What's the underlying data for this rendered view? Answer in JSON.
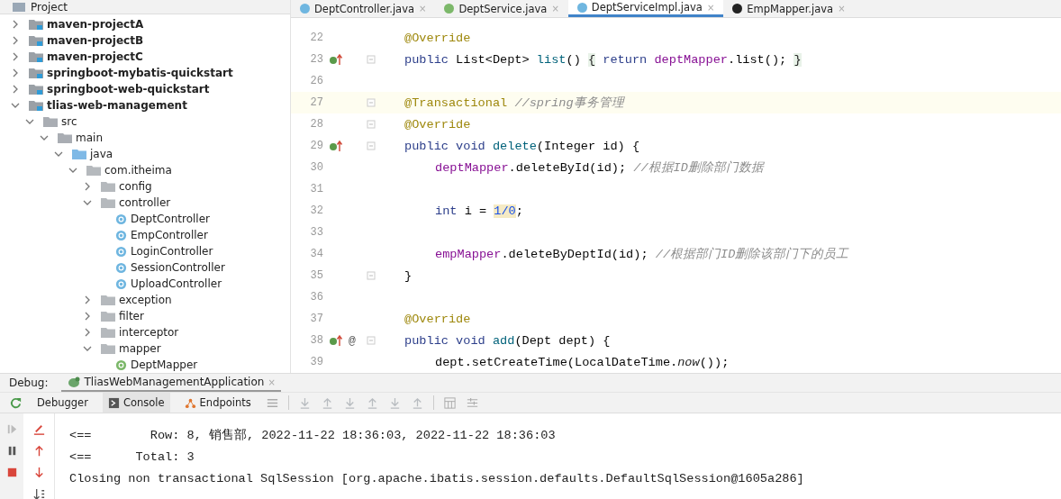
{
  "project_panel": {
    "title": "Project",
    "tree": [
      {
        "label": "maven-projectA",
        "kind": "module",
        "expanded": false
      },
      {
        "label": "maven-projectB",
        "kind": "module",
        "expanded": false
      },
      {
        "label": "maven-projectC",
        "kind": "module",
        "expanded": false
      },
      {
        "label": "springboot-mybatis-quickstart",
        "kind": "module",
        "expanded": false
      },
      {
        "label": "springboot-web-quickstart",
        "kind": "module",
        "expanded": false
      },
      {
        "label": "tlias-web-management",
        "kind": "module",
        "expanded": true,
        "children": [
          {
            "label": "src",
            "kind": "folder",
            "expanded": true,
            "children": [
              {
                "label": "main",
                "kind": "folder",
                "expanded": true,
                "children": [
                  {
                    "label": "java",
                    "kind": "source",
                    "expanded": true,
                    "children": [
                      {
                        "label": "com.itheima",
                        "kind": "package",
                        "expanded": true,
                        "children": [
                          {
                            "label": "config",
                            "kind": "package",
                            "expanded": false
                          },
                          {
                            "label": "controller",
                            "kind": "package",
                            "expanded": true,
                            "children": [
                              {
                                "label": "DeptController",
                                "kind": "class"
                              },
                              {
                                "label": "EmpController",
                                "kind": "class"
                              },
                              {
                                "label": "LoginController",
                                "kind": "class"
                              },
                              {
                                "label": "SessionController",
                                "kind": "class"
                              },
                              {
                                "label": "UploadController",
                                "kind": "class"
                              }
                            ]
                          },
                          {
                            "label": "exception",
                            "kind": "package",
                            "expanded": false
                          },
                          {
                            "label": "filter",
                            "kind": "package",
                            "expanded": false
                          },
                          {
                            "label": "interceptor",
                            "kind": "package",
                            "expanded": false
                          },
                          {
                            "label": "mapper",
                            "kind": "package",
                            "expanded": true,
                            "children": [
                              {
                                "label": "DeptMapper",
                                "kind": "interface"
                              }
                            ]
                          }
                        ]
                      }
                    ]
                  }
                ]
              }
            ]
          }
        ]
      }
    ]
  },
  "editor_tabs": [
    {
      "label": "DeptController.java",
      "kind": "class",
      "close": "×",
      "selected": false
    },
    {
      "label": "DeptService.java",
      "kind": "interface",
      "close": "×",
      "selected": false
    },
    {
      "label": "DeptServiceImpl.java",
      "kind": "class",
      "close": "×",
      "selected": true
    },
    {
      "label": "EmpMapper.java",
      "kind": "mapper",
      "close": "×",
      "selected": false
    }
  ],
  "code": [
    {
      "number": "22",
      "current": false,
      "override_marker": false,
      "fold": false,
      "kind": "member",
      "tokens": [
        {
          "t": "@Override",
          "kind": "ann"
        }
      ]
    },
    {
      "number": "23",
      "current": false,
      "override_marker": true,
      "fold": true,
      "kind": "member",
      "tokens": [
        {
          "t": "public ",
          "kind": "kw"
        },
        {
          "t": "List<Dept> ",
          "kind": "plain"
        },
        {
          "t": "list",
          "kind": "method"
        },
        {
          "t": "() ",
          "kind": "plain"
        },
        {
          "t": "{",
          "kind": "brace"
        },
        {
          "t": " return ",
          "kind": "kw"
        },
        {
          "t": "deptMapper",
          "kind": "field"
        },
        {
          "t": ".list(); ",
          "kind": "plain"
        },
        {
          "t": "}",
          "kind": "brace"
        }
      ]
    },
    {
      "number": "26",
      "current": false,
      "override_marker": false,
      "fold": false
    },
    {
      "number": "27",
      "current": true,
      "override_marker": false,
      "fold": true,
      "kind": "member",
      "tokens": [
        {
          "t": "@Transactional ",
          "kind": "ann"
        },
        {
          "t": "//spring事务管理",
          "kind": "comment"
        }
      ]
    },
    {
      "number": "28",
      "current": false,
      "override_marker": false,
      "fold": true,
      "kind": "member",
      "tokens": [
        {
          "t": "@Override",
          "kind": "ann"
        }
      ]
    },
    {
      "number": "29",
      "current": false,
      "override_marker": true,
      "fold": true,
      "kind": "member",
      "tokens": [
        {
          "t": "public void ",
          "kind": "kw"
        },
        {
          "t": "delete",
          "kind": "method"
        },
        {
          "t": "(Integer id) {",
          "kind": "plain"
        }
      ]
    },
    {
      "number": "30",
      "current": false,
      "override_marker": false,
      "fold": false,
      "kind": "body",
      "tokens": [
        {
          "t": "deptMapper",
          "kind": "field"
        },
        {
          "t": ".deleteById(id); ",
          "kind": "plain"
        },
        {
          "t": "//根据ID删除部门数据",
          "kind": "comment"
        }
      ]
    },
    {
      "number": "31",
      "current": false,
      "override_marker": false,
      "fold": false
    },
    {
      "number": "32",
      "current": false,
      "override_marker": false,
      "fold": false,
      "kind": "body",
      "tokens": [
        {
          "t": "int ",
          "kind": "kw"
        },
        {
          "t": "i = ",
          "kind": "plain"
        },
        {
          "t": "1/0",
          "kind": "warning"
        },
        {
          "t": ";",
          "kind": "plain"
        }
      ]
    },
    {
      "number": "33",
      "current": false,
      "override_marker": false,
      "fold": false
    },
    {
      "number": "34",
      "current": false,
      "override_marker": false,
      "fold": false,
      "kind": "body",
      "tokens": [
        {
          "t": "empMapper",
          "kind": "field"
        },
        {
          "t": ".deleteByDeptId(id); ",
          "kind": "plain"
        },
        {
          "t": "//根据部门ID删除该部门下的员工",
          "kind": "comment"
        }
      ]
    },
    {
      "number": "35",
      "current": false,
      "override_marker": false,
      "fold": true,
      "kind": "member",
      "tokens": [
        {
          "t": "}",
          "kind": "plain"
        }
      ]
    },
    {
      "number": "36",
      "current": false,
      "override_marker": false,
      "fold": false
    },
    {
      "number": "37",
      "current": false,
      "override_marker": false,
      "fold": false,
      "kind": "member",
      "tokens": [
        {
          "t": "@Override",
          "kind": "ann"
        }
      ]
    },
    {
      "number": "38",
      "current": false,
      "override_marker": true,
      "at_marker": "@",
      "fold": true,
      "kind": "member",
      "tokens": [
        {
          "t": "public void ",
          "kind": "kw"
        },
        {
          "t": "add",
          "kind": "method"
        },
        {
          "t": "(Dept dept) {",
          "kind": "plain"
        }
      ]
    },
    {
      "number": "39",
      "current": false,
      "override_marker": false,
      "fold": false,
      "kind": "body",
      "tokens": [
        {
          "t": "dept.setCreateTime(LocalDateTime.",
          "kind": "plain"
        },
        {
          "t": "now",
          "kind": "static"
        },
        {
          "t": "());",
          "kind": "plain"
        }
      ]
    }
  ],
  "debug": {
    "label": "Debug:",
    "session_tab": {
      "label": "TliasWebManagementApplication",
      "close": "×"
    },
    "tabs": [
      {
        "label": "Debugger",
        "kind": "plain",
        "selected": false
      },
      {
        "label": "Console",
        "kind": "console",
        "selected": true
      },
      {
        "label": "Endpoints",
        "kind": "endpoints",
        "selected": false
      }
    ],
    "console_lines": [
      "<==        Row: 8, 销售部, 2022-11-22 18:36:03, 2022-11-22 18:36:03",
      "<==      Total: 3",
      "Closing non transactional SqlSession [org.apache.ibatis.session.defaults.DefaultSqlSession@1605a286]"
    ]
  }
}
